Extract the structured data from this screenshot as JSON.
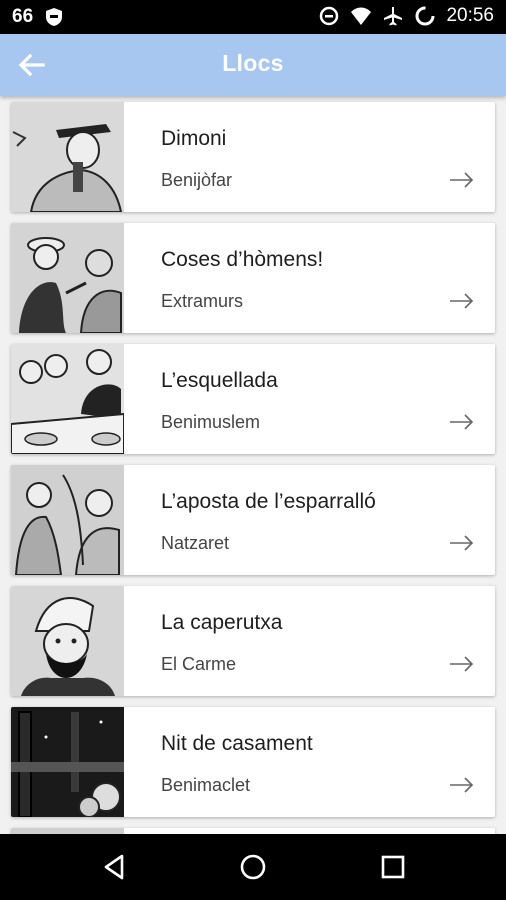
{
  "status_bar": {
    "left_number": "66",
    "time": "20:56",
    "icons": [
      "shield-icon",
      "data-saver-icon",
      "wifi-icon",
      "airplane-icon",
      "loading-icon"
    ]
  },
  "app_bar": {
    "title": "Llocs",
    "back_icon": "arrow-back-icon",
    "color": "#a7c7f0"
  },
  "places": [
    {
      "title": "Dimoni",
      "subtitle": "Benijòfar",
      "icon": "arrow-right-icon"
    },
    {
      "title": "Coses d’hòmens!",
      "subtitle": "Extramurs",
      "icon": "arrow-right-icon"
    },
    {
      "title": "L’esquellada",
      "subtitle": "Benimuslem",
      "icon": "arrow-right-icon"
    },
    {
      "title": "L’aposta de l’esparralló",
      "subtitle": "Natzaret",
      "icon": "arrow-right-icon"
    },
    {
      "title": "La caperutxa",
      "subtitle": "El Carme",
      "icon": "arrow-right-icon"
    },
    {
      "title": "Nit de casament",
      "subtitle": "Benimaclet",
      "icon": "arrow-right-icon"
    }
  ],
  "nav_bar": {
    "icons": [
      "back-triangle-icon",
      "home-circle-icon",
      "recents-square-icon"
    ]
  }
}
